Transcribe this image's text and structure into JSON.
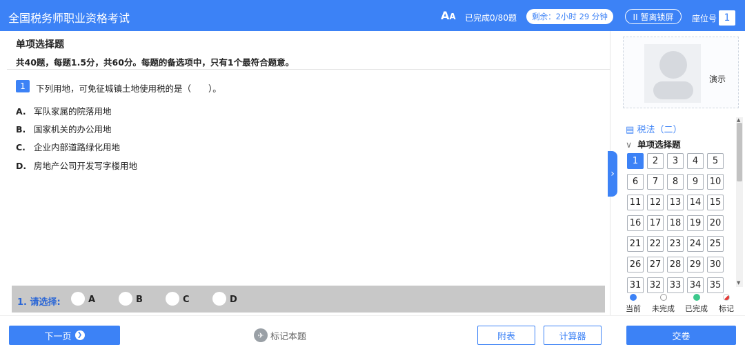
{
  "header": {
    "app_title": "全国税务师职业资格考试",
    "font_size_label": "A",
    "progress": "已完成0/80题",
    "timer": "剩余：2小时 29 分钟",
    "pause_label": "II 暂离锁屏",
    "seat_label": "座位号",
    "seat_number": "1"
  },
  "section": {
    "title": "单项选择题",
    "description": "共40题，每题1.5分，共60分。每题的备选项中，只有1个最符合题意。"
  },
  "question": {
    "number": "1",
    "text": "下列用地，可免征城镇土地使用税的是（　　）。",
    "options": [
      {
        "letter": "A.",
        "text": "军队家属的院落用地"
      },
      {
        "letter": "B.",
        "text": "国家机关的办公用地"
      },
      {
        "letter": "C.",
        "text": "企业内部道路绿化用地"
      },
      {
        "letter": "D.",
        "text": "房地产公司开发写字楼用地"
      }
    ]
  },
  "answer": {
    "label": "1. 请选择:",
    "choices": [
      "A",
      "B",
      "C",
      "D"
    ]
  },
  "sidebar": {
    "candidate_name": "演示",
    "subject": "税法（二）",
    "group_label": "单项选择题",
    "questions": [
      "1",
      "2",
      "3",
      "4",
      "5",
      "6",
      "7",
      "8",
      "9",
      "10",
      "11",
      "12",
      "13",
      "14",
      "15",
      "16",
      "17",
      "18",
      "19",
      "20",
      "21",
      "22",
      "23",
      "24",
      "25",
      "26",
      "27",
      "28",
      "29",
      "30",
      "31",
      "32",
      "33",
      "34",
      "35"
    ],
    "current": "1",
    "legend": [
      {
        "label": "当前",
        "color": "#3c82f6"
      },
      {
        "label": "未完成",
        "color": "#ffffff"
      },
      {
        "label": "已完成",
        "color": "#3cc88c"
      },
      {
        "label": "标记",
        "color": "#e53935"
      }
    ]
  },
  "footer": {
    "next_label": "下一页",
    "mark_label": "标记本题",
    "appendix_label": "附表",
    "calculator_label": "计算器",
    "submit_label": "交卷"
  }
}
